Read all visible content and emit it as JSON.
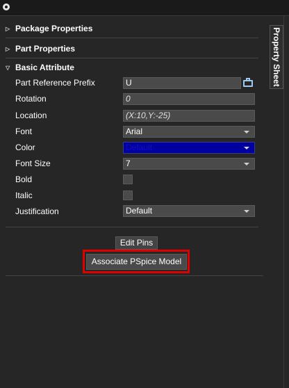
{
  "sections": {
    "package_properties": "Package Properties",
    "part_properties": "Part Properties",
    "basic_attribute": "Basic Attribute"
  },
  "properties": {
    "part_reference_prefix": {
      "label": "Part Reference Prefix",
      "value": "U"
    },
    "rotation": {
      "label": "Rotation",
      "value": "0"
    },
    "location": {
      "label": "Location",
      "value": "(X:10,Y:-25)"
    },
    "font": {
      "label": "Font",
      "value": "Arial"
    },
    "color": {
      "label": "Color",
      "value": "Default",
      "swatch": "#0000a0"
    },
    "font_size": {
      "label": "Font Size",
      "value": "7"
    },
    "bold": {
      "label": "Bold"
    },
    "italic": {
      "label": "Italic"
    },
    "justification": {
      "label": "Justification",
      "value": "Default"
    }
  },
  "buttons": {
    "edit_pins": "Edit Pins",
    "associate_pspice": "Associate PSpice Model"
  },
  "side_tab": "Property Sheet",
  "colors": {
    "highlight": "#e00000",
    "panel_bg": "#262626"
  }
}
